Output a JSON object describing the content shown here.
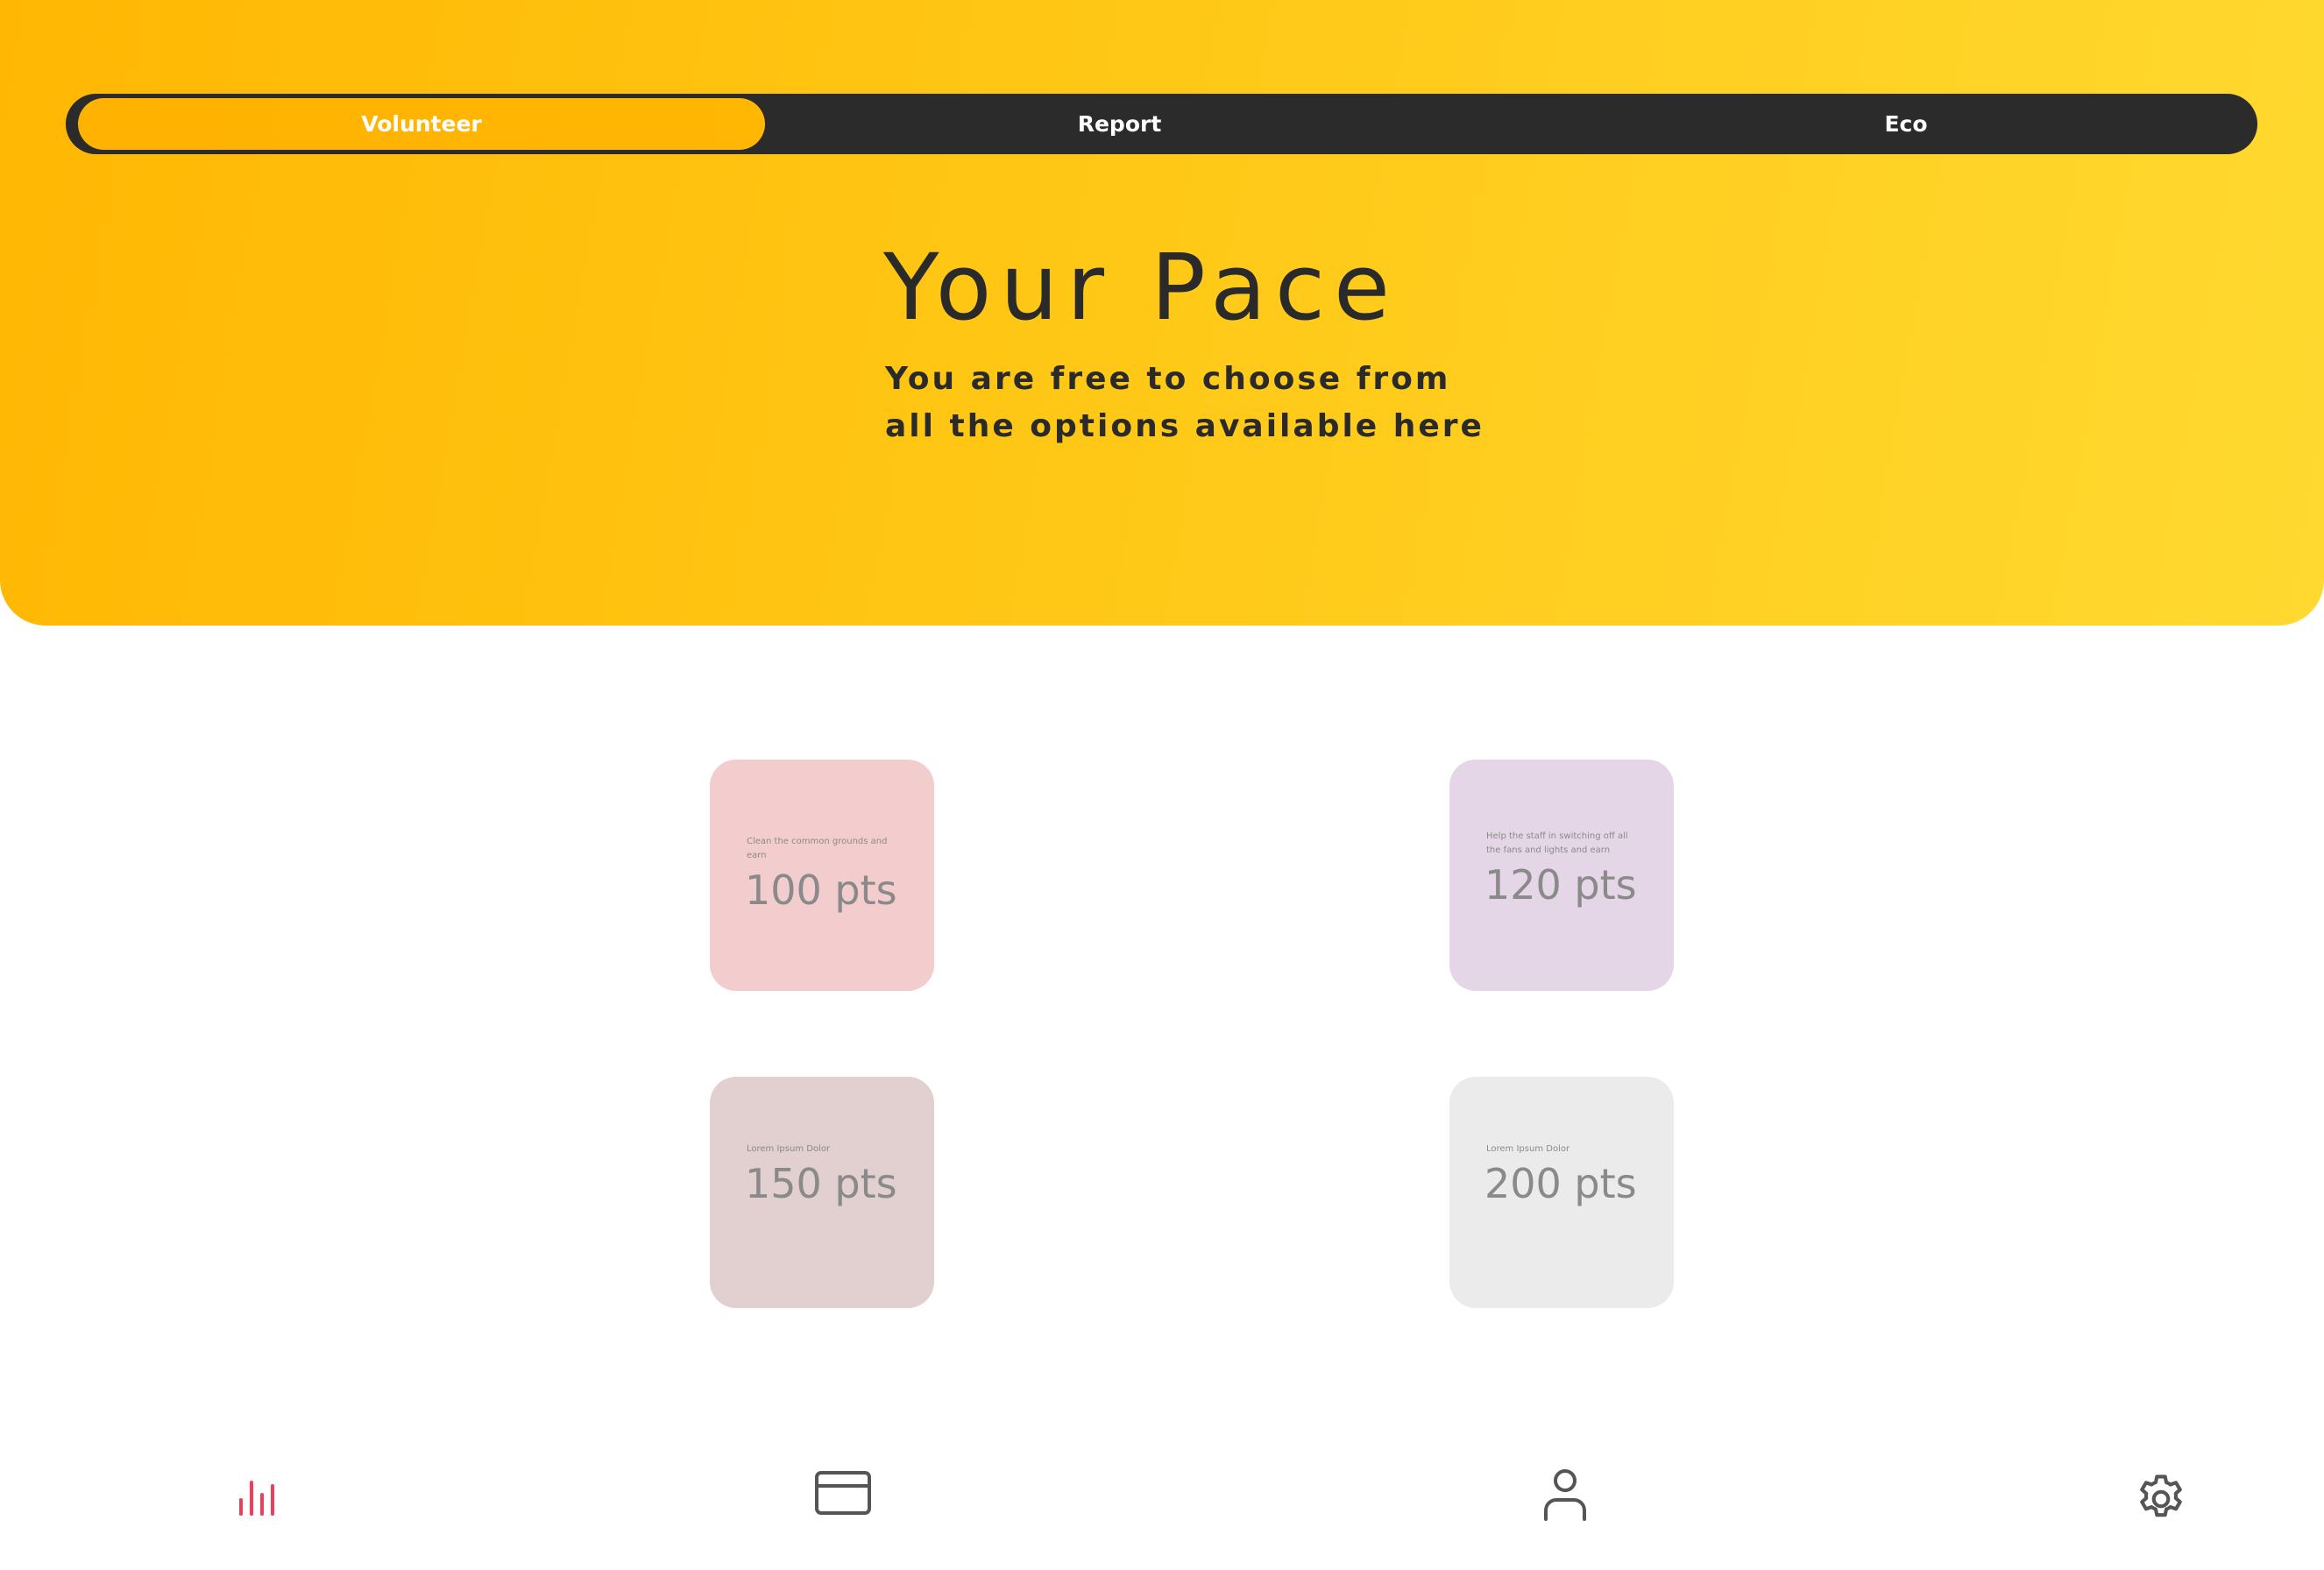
{
  "tabs": [
    {
      "label": "Volunteer",
      "active": true
    },
    {
      "label": "Report",
      "active": false
    },
    {
      "label": "Eco",
      "active": false
    }
  ],
  "hero": {
    "title": "Your Pace",
    "subtitle": "You are free to choose from all the options available here"
  },
  "cards": [
    {
      "description": "Clean the common grounds and earn",
      "points": "100 pts",
      "color": "#f3cdcd"
    },
    {
      "description": "Help the staff in switching off all the fans and lights and earn",
      "points": "120 pts",
      "color": "#e4d6e7"
    },
    {
      "description": "Lorem Ipsum Dolor",
      "points": "150 pts",
      "color": "#e2cfcf"
    },
    {
      "description": "Lorem Ipsum Dolor",
      "points": "200 pts",
      "color": "#ebebeb"
    }
  ],
  "bottom_nav": [
    {
      "icon": "bar-chart-icon",
      "active": true
    },
    {
      "icon": "credit-card-icon",
      "active": false
    },
    {
      "icon": "user-icon",
      "active": false
    },
    {
      "icon": "gear-icon",
      "active": false
    }
  ],
  "colors": {
    "accent": "#ffb703",
    "hero_gradient_start": "#ffb703",
    "hero_gradient_end": "#ffd930",
    "tab_bar": "#2b2b2b",
    "active_nav": "#ef3e5c",
    "text_dark": "#2a2a2a"
  }
}
